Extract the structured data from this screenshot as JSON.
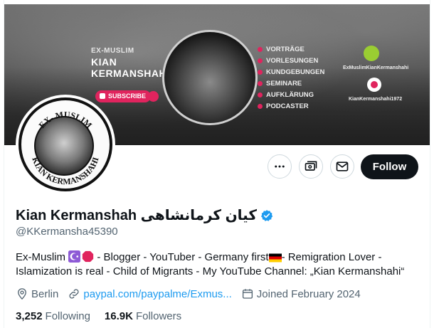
{
  "banner": {
    "ex_label": "EX-MUSLIM",
    "name_line1": "KIAN",
    "name_line2": "KERMANSHAHI",
    "subscribe_label": "SUBSCRIBE",
    "list": [
      "VORTRÄGE",
      "VORLESUNGEN",
      "KUNDGEBUNGEN",
      "SEMINARE",
      "AUFKLÄRUNG",
      "PODCASTER"
    ],
    "youtube_label": "ExMuslimKianKermanshahi",
    "podcast_label": "KianKermanshahi1972"
  },
  "avatar": {
    "top_text": "EX- MUSLIM",
    "bottom_text": "KIAN KERMANSHAHI"
  },
  "actions": {
    "more_icon": "more-icon",
    "subscribe_icon": "subscribe-icon",
    "message_icon": "mail-icon",
    "follow_label": "Follow"
  },
  "profile": {
    "display_name": "Kian Kermanshah کیان کرمانشاهی",
    "handle": "@KKermansha45390",
    "bio_part1": "Ex-Muslim ",
    "bio_part2": " - Blogger - YouTuber - Germany first",
    "bio_part3": "- Remigration Lover - Islamization is real - Child of Migrants - My YouTube Channel: „Kian Kermanshahi“",
    "location": "Berlin",
    "website": "paypal.com/paypalme/Exmus...",
    "joined": "Joined February 2024",
    "following_count": "3,252",
    "following_label": "Following",
    "followers_count": "16.9K",
    "followers_label": "Followers"
  },
  "colors": {
    "accent": "#1d9bf0",
    "follow_bg": "#0f1419",
    "muted": "#536471",
    "brand_red": "#e0245e"
  }
}
